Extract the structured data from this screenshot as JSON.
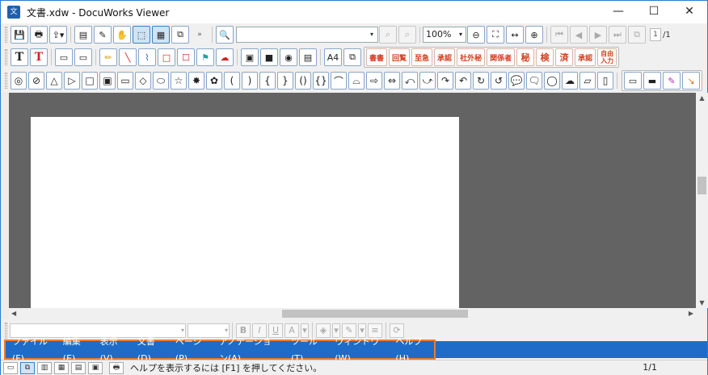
{
  "window": {
    "title": "文書.xdw - DocuWorks Viewer",
    "app_icon": "docuworks-icon",
    "controls": {
      "minimize": "—",
      "maximize": "☐",
      "close": "✕"
    }
  },
  "toolbar1": {
    "search_dropdown": "▾",
    "zoom": "100%",
    "zoom_dropdown": "▾",
    "page_current": "1",
    "page_total": "/1"
  },
  "toolbar2": {
    "text_black": "T",
    "text_red": "T",
    "stamps": [
      "書書",
      "回覧",
      "至急",
      "承認",
      "社外秘",
      "関係者"
    ],
    "round_stamps": [
      "秘",
      "検",
      "済"
    ],
    "date_stamp": "承認",
    "input_stamp": "自由\n入力"
  },
  "toolbar3": {
    "shapes": [
      "◎",
      "⊘",
      "△",
      "▷",
      "□",
      "▣",
      "▭",
      "◇",
      "⬭",
      "☆",
      "✸",
      "✿",
      "(",
      ")",
      "{",
      "}",
      "()",
      "{}",
      "⌒",
      "⌓",
      "⇨",
      "⇔",
      "⤺",
      "⤻",
      "↷",
      "↶",
      "↻",
      "↺",
      "💬",
      "🗨",
      "◯",
      "☁",
      "▱",
      "▯"
    ]
  },
  "formatbar": {
    "bold": "B",
    "italic": "I",
    "underline": "U",
    "font_color": "A"
  },
  "menubar": {
    "items": [
      "ファイル(F)",
      "編集(E)",
      "表示(V)",
      "文書(D)",
      "ページ(P)",
      "アノテーション(A)",
      "ツール(T)",
      "ウィンドウ(W)",
      "ヘルプ(H)"
    ]
  },
  "statusbar": {
    "message": "ヘルプを表示するには [F1] を押してください。",
    "page": "1/1"
  },
  "colors": {
    "menu_bg": "#1e6cc7",
    "highlight_border": "#f07a2a",
    "workspace": "#636363"
  }
}
